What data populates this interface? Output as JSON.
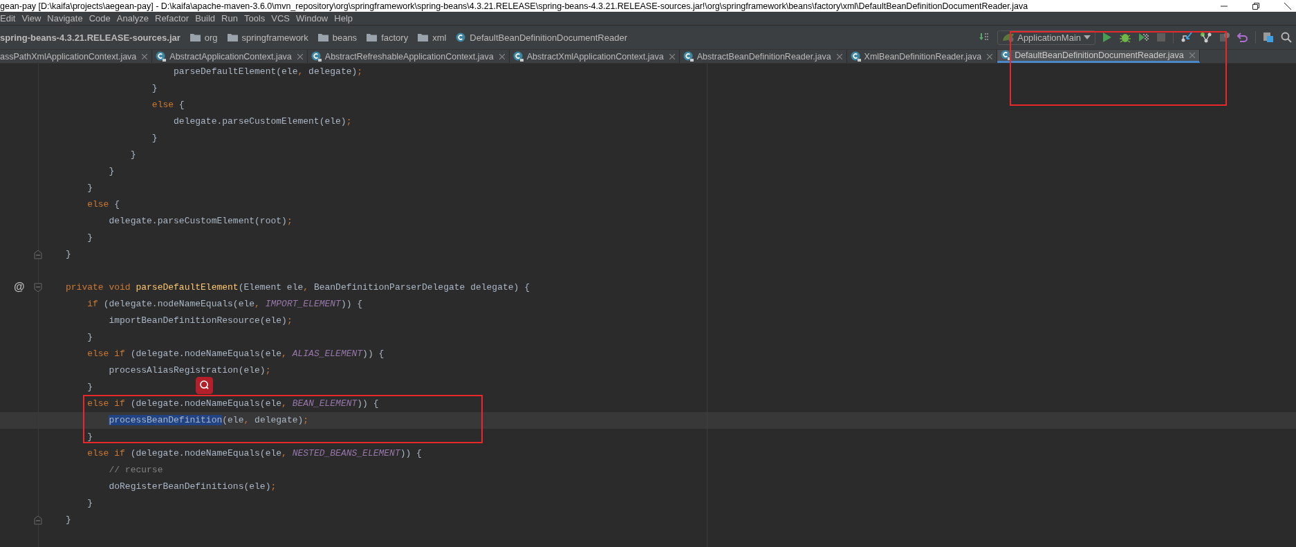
{
  "window": {
    "title": "gean-pay [D:\\kaifa\\projects\\aegean-pay] - D:\\kaifa\\apache-maven-3.6.0\\mvn_repository\\org\\springframework\\spring-beans\\4.3.21.RELEASE\\spring-beans-4.3.21.RELEASE-sources.jar!\\org\\springframework\\beans\\factory\\xml\\DefaultBeanDefinitionDocumentReader.java"
  },
  "menu": [
    "Edit",
    "View",
    "Navigate",
    "Code",
    "Analyze",
    "Refactor",
    "Build",
    "Run",
    "Tools",
    "VCS",
    "Window",
    "Help"
  ],
  "breadcrumbs": [
    {
      "label": "spring-beans-4.3.21.RELEASE-sources.jar",
      "kind": "jar"
    },
    {
      "label": "org",
      "kind": "package"
    },
    {
      "label": "springframework",
      "kind": "package"
    },
    {
      "label": "beans",
      "kind": "package"
    },
    {
      "label": "factory",
      "kind": "package"
    },
    {
      "label": "xml",
      "kind": "package"
    },
    {
      "label": "DefaultBeanDefinitionDocumentReader",
      "kind": "class"
    }
  ],
  "run_config": {
    "label": "ApplicationMain"
  },
  "tabs": [
    {
      "label": "assPathXmlApplicationContext.java",
      "icon": false,
      "selected": false
    },
    {
      "label": "AbstractApplicationContext.java",
      "icon": true,
      "selected": false
    },
    {
      "label": "AbstractRefreshableApplicationContext.java",
      "icon": true,
      "selected": false
    },
    {
      "label": "AbstractXmlApplicationContext.java",
      "icon": true,
      "selected": false
    },
    {
      "label": "AbstractBeanDefinitionReader.java",
      "icon": true,
      "selected": false
    },
    {
      "label": "XmlBeanDefinitionReader.java",
      "icon": true,
      "selected": false
    },
    {
      "label": "DefaultBeanDefinitionDocumentReader.java",
      "icon": true,
      "selected": true
    }
  ],
  "lines": [
    {
      "tokens": [
        {
          "text": "                    parseDefaultElement(ele",
          "kind": "plain"
        },
        {
          "text": ",",
          "kind": "punct"
        },
        {
          "text": " delegate)",
          "kind": "plain"
        },
        {
          "text": ";",
          "kind": "punct"
        }
      ]
    },
    {
      "tokens": [
        {
          "text": "                }",
          "kind": "plain"
        }
      ]
    },
    {
      "tokens": [
        {
          "text": "                else",
          "kind": "keyword"
        },
        {
          "text": " {",
          "kind": "plain"
        }
      ]
    },
    {
      "tokens": [
        {
          "text": "                    delegate.parseCustomElement(ele)",
          "kind": "plain"
        },
        {
          "text": ";",
          "kind": "punct"
        }
      ]
    },
    {
      "tokens": [
        {
          "text": "                }",
          "kind": "plain"
        }
      ]
    },
    {
      "tokens": [
        {
          "text": "            }",
          "kind": "plain"
        }
      ]
    },
    {
      "tokens": [
        {
          "text": "        }",
          "kind": "plain"
        }
      ]
    },
    {
      "tokens": [
        {
          "text": "    }",
          "kind": "plain"
        }
      ]
    },
    {
      "tokens": [
        {
          "text": "    else",
          "kind": "keyword"
        },
        {
          "text": " {",
          "kind": "plain"
        }
      ]
    },
    {
      "tokens": [
        {
          "text": "        delegate.parseCustomElement(root)",
          "kind": "plain"
        },
        {
          "text": ";",
          "kind": "punct"
        }
      ]
    },
    {
      "tokens": [
        {
          "text": "    }",
          "kind": "plain"
        }
      ]
    },
    {
      "kind": "fold-end",
      "tokens": [
        {
          "text": "}",
          "kind": "plain"
        }
      ]
    },
    {
      "kind": "blank"
    },
    {
      "kind": "fold-start",
      "marker": "@",
      "tokens": [
        {
          "text": "private void ",
          "kind": "keyword"
        },
        {
          "text": "parseDefaultElement",
          "kind": "declaration"
        },
        {
          "text": "(Element ele",
          "kind": "plain"
        },
        {
          "text": ",",
          "kind": "punct"
        },
        {
          "text": " BeanDefinitionParserDelegate delegate) {",
          "kind": "plain"
        }
      ]
    },
    {
      "tokens": [
        {
          "text": "    if ",
          "kind": "keyword"
        },
        {
          "text": "(delegate.nodeNameEquals(ele",
          "kind": "plain"
        },
        {
          "text": ", ",
          "kind": "punct"
        },
        {
          "text": "IMPORT_ELEMENT",
          "kind": "constant"
        },
        {
          "text": ")) {",
          "kind": "plain"
        }
      ]
    },
    {
      "tokens": [
        {
          "text": "        importBeanDefinitionResource(ele)",
          "kind": "plain"
        },
        {
          "text": ";",
          "kind": "punct"
        }
      ]
    },
    {
      "tokens": [
        {
          "text": "    }",
          "kind": "plain"
        }
      ]
    },
    {
      "tokens": [
        {
          "text": "    else if ",
          "kind": "keyword"
        },
        {
          "text": "(delegate.nodeNameEquals(ele",
          "kind": "plain"
        },
        {
          "text": ", ",
          "kind": "punct"
        },
        {
          "text": "ALIAS_ELEMENT",
          "kind": "constant"
        },
        {
          "text": ")) {",
          "kind": "plain"
        }
      ]
    },
    {
      "tokens": [
        {
          "text": "        processAliasRegistration(ele)",
          "kind": "plain"
        },
        {
          "text": ";",
          "kind": "punct"
        }
      ]
    },
    {
      "tokens": [
        {
          "text": "    }",
          "kind": "plain"
        }
      ]
    },
    {
      "tokens": [
        {
          "text": "    else if ",
          "kind": "keyword"
        },
        {
          "text": "(delegate.nodeNameEquals(ele",
          "kind": "plain"
        },
        {
          "text": ", ",
          "kind": "punct"
        },
        {
          "text": "BEAN_ELEMENT",
          "kind": "constant"
        },
        {
          "text": ")) {",
          "kind": "plain"
        }
      ]
    },
    {
      "current_line": true,
      "tokens": [
        {
          "text": "        processBeanDefinition",
          "kind": "selection"
        },
        {
          "text": "(ele",
          "kind": "plain"
        },
        {
          "text": ",",
          "kind": "punct"
        },
        {
          "text": " delegate)",
          "kind": "plain"
        },
        {
          "text": ";",
          "kind": "punct"
        }
      ]
    },
    {
      "tokens": [
        {
          "text": "    }",
          "kind": "plain"
        }
      ]
    },
    {
      "tokens": [
        {
          "text": "    else if ",
          "kind": "keyword"
        },
        {
          "text": "(delegate.nodeNameEquals(ele",
          "kind": "plain"
        },
        {
          "text": ", ",
          "kind": "punct"
        },
        {
          "text": "NESTED_BEANS_ELEMENT",
          "kind": "constant"
        },
        {
          "text": ")) {",
          "kind": "plain"
        }
      ]
    },
    {
      "tokens": [
        {
          "text": "        // recurse",
          "kind": "comment"
        }
      ]
    },
    {
      "tokens": [
        {
          "text": "        doRegisterBeanDefinitions(ele)",
          "kind": "plain"
        },
        {
          "text": ";",
          "kind": "punct"
        }
      ]
    },
    {
      "tokens": [
        {
          "text": "    }",
          "kind": "plain"
        }
      ]
    },
    {
      "kind": "fold-end",
      "tokens": [
        {
          "text": "}",
          "kind": "plain"
        }
      ]
    }
  ]
}
